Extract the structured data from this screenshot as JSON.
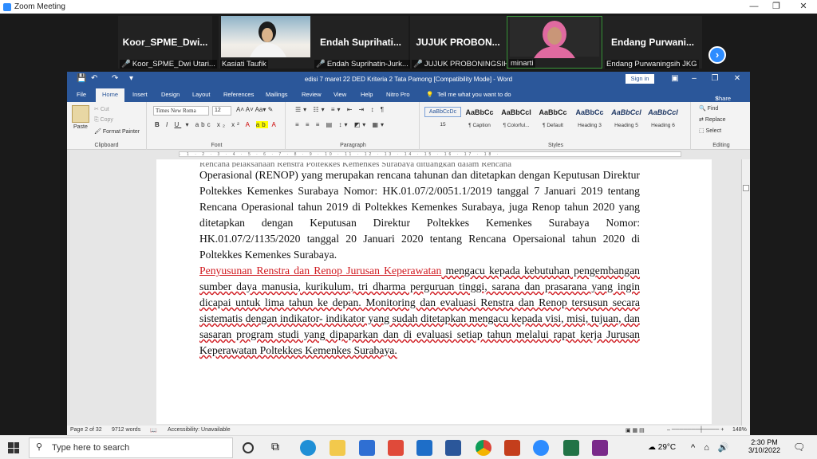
{
  "zoom": {
    "title": "Zoom Meeting"
  },
  "participants": [
    {
      "name": "Koor_SPME_Dwi...",
      "label": "Koor_SPME_Dwi Utari...",
      "video": false
    },
    {
      "name": "",
      "label": "Kasiati Taufik",
      "video": true
    },
    {
      "name": "Endah Suprihati...",
      "label": "Endah Suprihatin-Jurk...",
      "video": false
    },
    {
      "name": "JUJUK PROBON...",
      "label": "JUJUK PROBONINGSIH",
      "video": false
    },
    {
      "name": "",
      "label": "minarti",
      "video": true
    },
    {
      "name": "Endang Purwani...",
      "label": "Endang Purwaningsih JKG",
      "video": false
    }
  ],
  "word": {
    "doc_title": "edisi 7 maret 22 DED Kriteria 2   Tata Pamong [Compatibility Mode]  -  Word",
    "sign_in": "Sign in",
    "tabs": [
      "File",
      "Home",
      "Insert",
      "Design",
      "Layout",
      "References",
      "Mailings",
      "Review",
      "View",
      "Help",
      "Nitro Pro"
    ],
    "tell_me": "Tell me what you want to do",
    "share": "Share",
    "clipboard": {
      "paste": "Paste",
      "cut": "Cut",
      "copy": "Copy",
      "format_painter": "Format Painter",
      "label": "Clipboard"
    },
    "font": {
      "name": "Times New Roma",
      "size": "12",
      "label": "Font"
    },
    "paragraph_label": "Paragraph",
    "styles": [
      {
        "sample": "AaBbCcDc",
        "name": "15"
      },
      {
        "sample": "AaBbCc",
        "name": "¶ Caption"
      },
      {
        "sample": "AaBbCcI",
        "name": "¶ Colorful..."
      },
      {
        "sample": "AaBbCc",
        "name": "¶ Default"
      },
      {
        "sample": "AaBbCc",
        "name": "Heading 3"
      },
      {
        "sample": "AaBbCcl",
        "name": "Heading 5"
      },
      {
        "sample": "AaBbCcl",
        "name": "Heading 6"
      }
    ],
    "styles_label": "Styles",
    "editing": {
      "find": "Find",
      "replace": "Replace",
      "select": "Select",
      "label": "Editing"
    },
    "doc": {
      "cut_line": "Rencana pelaksanaan Renstra Poltekkes Kemenkes Surabaya dituangkan dalam Rencana",
      "para1": "Operasional (RENOP) yang merupakan rencana tahunan dan ditetapkan dengan Keputusan Direktur Poltekkes Kemenkes Surabaya Nomor: HK.01.07/2/0051.1/2019 tanggal 7 Januari 2019 tentang Rencana Operasional tahun 2019 di Poltekkes Kemenkes Surabaya, juga Renop tahun 2020 yang ditetapkan dengan Keputusan Direktur Poltekkes Kemenkes Surabaya Nomor: HK.01.07/2/1135/2020 tanggal 20 Januari 2020 tentang Rencana Opersaional tahun 2020 di Poltekkes Kemenkes Surabaya.",
      "para2_red": "Penyusunan Renstra dan Renop Jurusan Keperawatan",
      "para2_rest": " mengacu kepada kebutuhan pengembangan sumber daya manusia, kurikulum, tri dharma perguruan tinggi, sarana dan prasarana yang ingin dicapai untuk lima tahun ke depan. Monitoring dan evaluasi Renstra dan Renop tersusun secara sistematis dengan indikator- indikator yang sudah ditetapkan mengacu kepada visi, misi, tujuan, dan sasaran program studi yang dipaparkan dan di evaluasi setiap tahun melalui rapat kerja Jurusan Keperawatan Poltekkes Kemenkes Surabaya."
    },
    "status": {
      "page": "Page 2 of 32",
      "words": "9712 words",
      "accessibility": "Accessibility: Unavailable",
      "zoom": "148%"
    }
  },
  "taskbar": {
    "search_placeholder": "Type here to search",
    "temp": "29°C",
    "time": "2:30 PM",
    "date": "3/10/2022"
  }
}
